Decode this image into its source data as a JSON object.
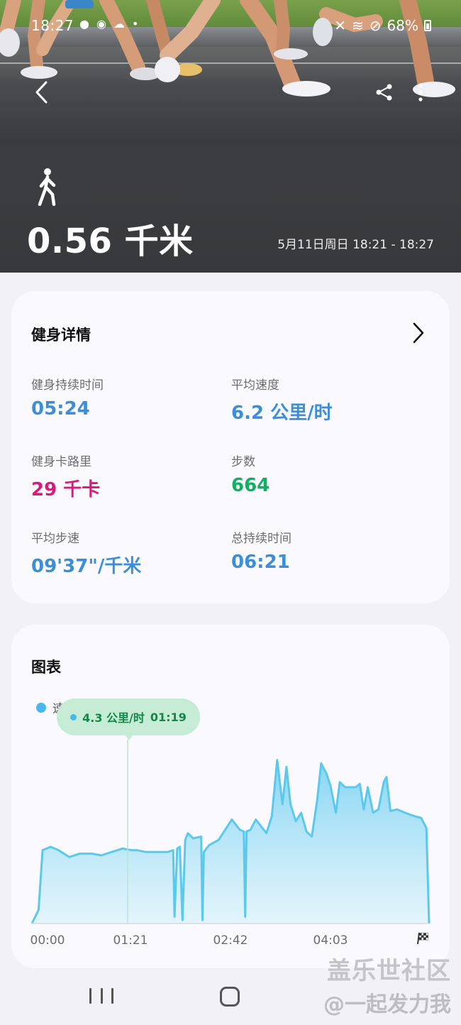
{
  "status_bar": {
    "time": "18:27",
    "battery": "68%"
  },
  "hero": {
    "distance": "0.56 千米",
    "date_range": "5月11日周日 18:21 - 18:27",
    "activity_icon": "walk-icon"
  },
  "details": {
    "title": "健身详情",
    "metrics": [
      {
        "label": "健身持续时间",
        "value": "05:24",
        "color": "#3c8ed8"
      },
      {
        "label": "平均速度",
        "value": "6.2 公里/时",
        "color": "#3c8ed8"
      },
      {
        "label": "健身卡路里",
        "value": "29 千卡",
        "color": "#d81b79"
      },
      {
        "label": "步数",
        "value": "664",
        "color": "#14ad61"
      },
      {
        "label": "平均步速",
        "value": "09'37\"/千米",
        "color": "#3c8ed8"
      },
      {
        "label": "总持续时间",
        "value": "06:21",
        "color": "#3c8ed8"
      }
    ]
  },
  "chart_section": {
    "title": "图表",
    "legend_label": "速度",
    "tooltip": {
      "value": "4.3 公里/时",
      "time": "01:19"
    }
  },
  "chart_data": {
    "type": "area",
    "x_unit": "seconds",
    "x_tick_labels": [
      "00:00",
      "01:21",
      "02:42",
      "04:03"
    ],
    "x_ticks_seconds": [
      0,
      81,
      162,
      243
    ],
    "x_end_seconds": 324,
    "series": [
      {
        "name": "速度",
        "color": "#5cc8ec",
        "points": [
          [
            0,
            0
          ],
          [
            5,
            0.8
          ],
          [
            8,
            4.3
          ],
          [
            14,
            4.5
          ],
          [
            20,
            4.3
          ],
          [
            28,
            3.9
          ],
          [
            36,
            4.1
          ],
          [
            45,
            4.1
          ],
          [
            52,
            4.0
          ],
          [
            60,
            4.2
          ],
          [
            68,
            4.4
          ],
          [
            75,
            4.3
          ],
          [
            79,
            4.3
          ],
          [
            85,
            4.2
          ],
          [
            92,
            4.2
          ],
          [
            102,
            4.2
          ],
          [
            106,
            4.3
          ],
          [
            107,
            0.4
          ],
          [
            109,
            4.4
          ],
          [
            111,
            4.5
          ],
          [
            113,
            0.2
          ],
          [
            115,
            4.9
          ],
          [
            117,
            5.3
          ],
          [
            121,
            5.0
          ],
          [
            127,
            5.1
          ],
          [
            128,
            0.2
          ],
          [
            129,
            4.2
          ],
          [
            133,
            4.6
          ],
          [
            140,
            4.9
          ],
          [
            145,
            5.5
          ],
          [
            150,
            6.1
          ],
          [
            156,
            5.5
          ],
          [
            159,
            5.4
          ],
          [
            160,
            0.4
          ],
          [
            161,
            5.4
          ],
          [
            164,
            5.5
          ],
          [
            168,
            6.1
          ],
          [
            172,
            5.7
          ],
          [
            176,
            5.3
          ],
          [
            180,
            6.3
          ],
          [
            184,
            9.6
          ],
          [
            188,
            7.0
          ],
          [
            191,
            9.2
          ],
          [
            194,
            7.0
          ],
          [
            198,
            6.0
          ],
          [
            202,
            6.5
          ],
          [
            206,
            5.4
          ],
          [
            210,
            5.1
          ],
          [
            214,
            7.2
          ],
          [
            217,
            9.4
          ],
          [
            221,
            8.8
          ],
          [
            224,
            8.1
          ],
          [
            228,
            6.5
          ],
          [
            231,
            8.3
          ],
          [
            235,
            8.0
          ],
          [
            239,
            8.0
          ],
          [
            243,
            8.0
          ],
          [
            246,
            8.2
          ],
          [
            249,
            6.7
          ],
          [
            252,
            8.0
          ],
          [
            256,
            6.5
          ],
          [
            260,
            6.7
          ],
          [
            264,
            8.3
          ],
          [
            266,
            8.6
          ],
          [
            269,
            6.6
          ],
          [
            274,
            6.7
          ],
          [
            280,
            6.5
          ],
          [
            287,
            6.3
          ],
          [
            292,
            6.2
          ],
          [
            296,
            5.6
          ],
          [
            298,
            0
          ]
        ]
      }
    ],
    "tooltip_point": {
      "time_seconds": 79,
      "value": 4.3,
      "unit": "公里/时"
    },
    "ylim": [
      0,
      10
    ],
    "grid": false,
    "legend_placement": "top-left"
  },
  "watermark": {
    "line1": "盖乐世社区",
    "line2": "@一起发力我"
  }
}
